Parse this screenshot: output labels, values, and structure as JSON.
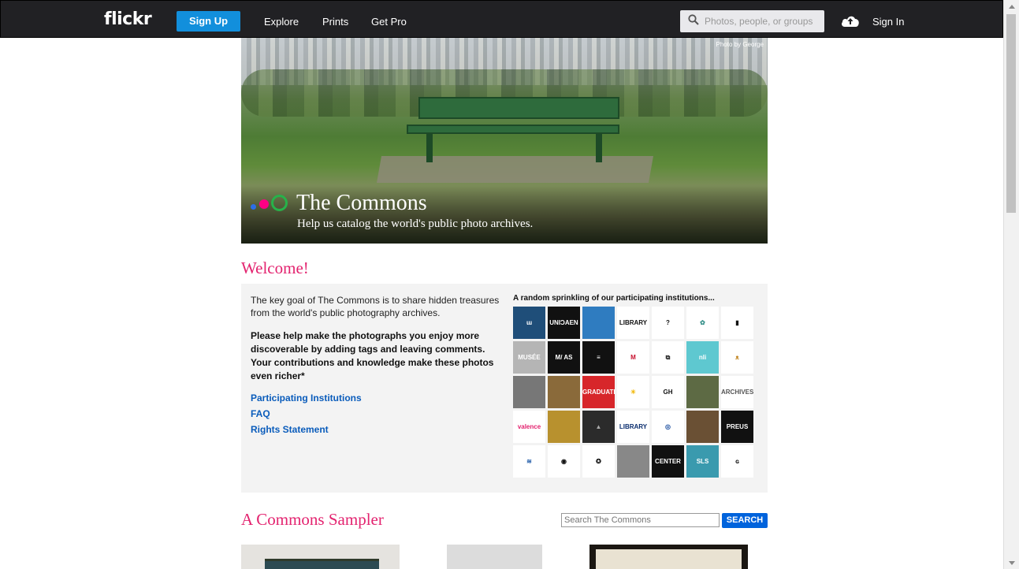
{
  "header": {
    "logo": "flickr",
    "signup": "Sign Up",
    "nav": [
      "Explore",
      "Prints",
      "Get Pro"
    ],
    "search_placeholder": "Photos, people, or groups",
    "signin": "Sign In"
  },
  "hero": {
    "credit": "Photo by George",
    "title": "The Commons",
    "subtitle": "Help us catalog the world's public photo archives."
  },
  "welcome": {
    "heading": "Welcome!",
    "intro": "The key goal of The Commons is to share hidden treasures from the world's public photography archives.",
    "bold": "Please help make the photographs you enjoy more discoverable by adding tags and leaving comments. Your contributions and knowledge make these photos even richer*",
    "links": [
      "Participating Institutions",
      "FAQ",
      "Rights Statement"
    ],
    "sprinkle": "A random sprinkling of our participating institutions...",
    "tiles": [
      {
        "label": "ɯ",
        "bg": "#1f4e79",
        "fg": "#fff"
      },
      {
        "label": "UNIƆAEN",
        "bg": "#111",
        "fg": "#fff"
      },
      {
        "label": "",
        "bg": "#2f7cc0",
        "fg": "#fff"
      },
      {
        "label": "LIBRARY",
        "bg": "#fff",
        "fg": "#111"
      },
      {
        "label": "?",
        "bg": "#fff",
        "fg": "#111"
      },
      {
        "label": "✿",
        "bg": "#fff",
        "fg": "#2f8c86"
      },
      {
        "label": "▮",
        "bg": "#fff",
        "fg": "#111"
      },
      {
        "label": "MUSÉE",
        "bg": "#b5b5b5",
        "fg": "#fff"
      },
      {
        "label": "M/ AS",
        "bg": "#111",
        "fg": "#fff"
      },
      {
        "label": "≡",
        "bg": "#111",
        "fg": "#fff"
      },
      {
        "label": "M",
        "bg": "#fff",
        "fg": "#c8102e"
      },
      {
        "label": "⧉",
        "bg": "#fff",
        "fg": "#111"
      },
      {
        "label": "nli",
        "bg": "#5ec8d0",
        "fg": "#fff"
      },
      {
        "label": "ᴥ",
        "bg": "#fff",
        "fg": "#c48a2a"
      },
      {
        "label": "",
        "bg": "#777",
        "fg": "#fff"
      },
      {
        "label": "",
        "bg": "#8a6a3a",
        "fg": "#fff"
      },
      {
        "label": "GRADUATE",
        "bg": "#d7262a",
        "fg": "#fff"
      },
      {
        "label": "☀",
        "bg": "#fff",
        "fg": "#f2b90c"
      },
      {
        "label": "GH",
        "bg": "#fff",
        "fg": "#111"
      },
      {
        "label": "",
        "bg": "#5d6a44",
        "fg": "#fff"
      },
      {
        "label": "ARCHIVES",
        "bg": "#fff",
        "fg": "#555"
      },
      {
        "label": "valence",
        "bg": "#fff",
        "fg": "#e3236f"
      },
      {
        "label": "",
        "bg": "#b8912e",
        "fg": "#fff"
      },
      {
        "label": "▲",
        "bg": "#2b2b2b",
        "fg": "#aaa"
      },
      {
        "label": "LIBRARY",
        "bg": "#fff",
        "fg": "#0a2d6e"
      },
      {
        "label": "◎",
        "bg": "#fff",
        "fg": "#1c4fa0"
      },
      {
        "label": "",
        "bg": "#6a5034",
        "fg": "#fff"
      },
      {
        "label": "PREUS",
        "bg": "#111",
        "fg": "#fff"
      },
      {
        "label": "≋",
        "bg": "#fff",
        "fg": "#1f5aa8"
      },
      {
        "label": "◉",
        "bg": "#fff",
        "fg": "#111"
      },
      {
        "label": "✪",
        "bg": "#fff",
        "fg": "#111"
      },
      {
        "label": "",
        "bg": "#888",
        "fg": "#fff"
      },
      {
        "label": "CENTER",
        "bg": "#111",
        "fg": "#fff"
      },
      {
        "label": "SLS",
        "bg": "#3a9aae",
        "fg": "#fff"
      },
      {
        "label": "ɢ",
        "bg": "#fff",
        "fg": "#111"
      }
    ]
  },
  "sampler": {
    "heading": "A Commons Sampler",
    "search_placeholder": "Search The Commons",
    "search_button": "SEARCH"
  }
}
